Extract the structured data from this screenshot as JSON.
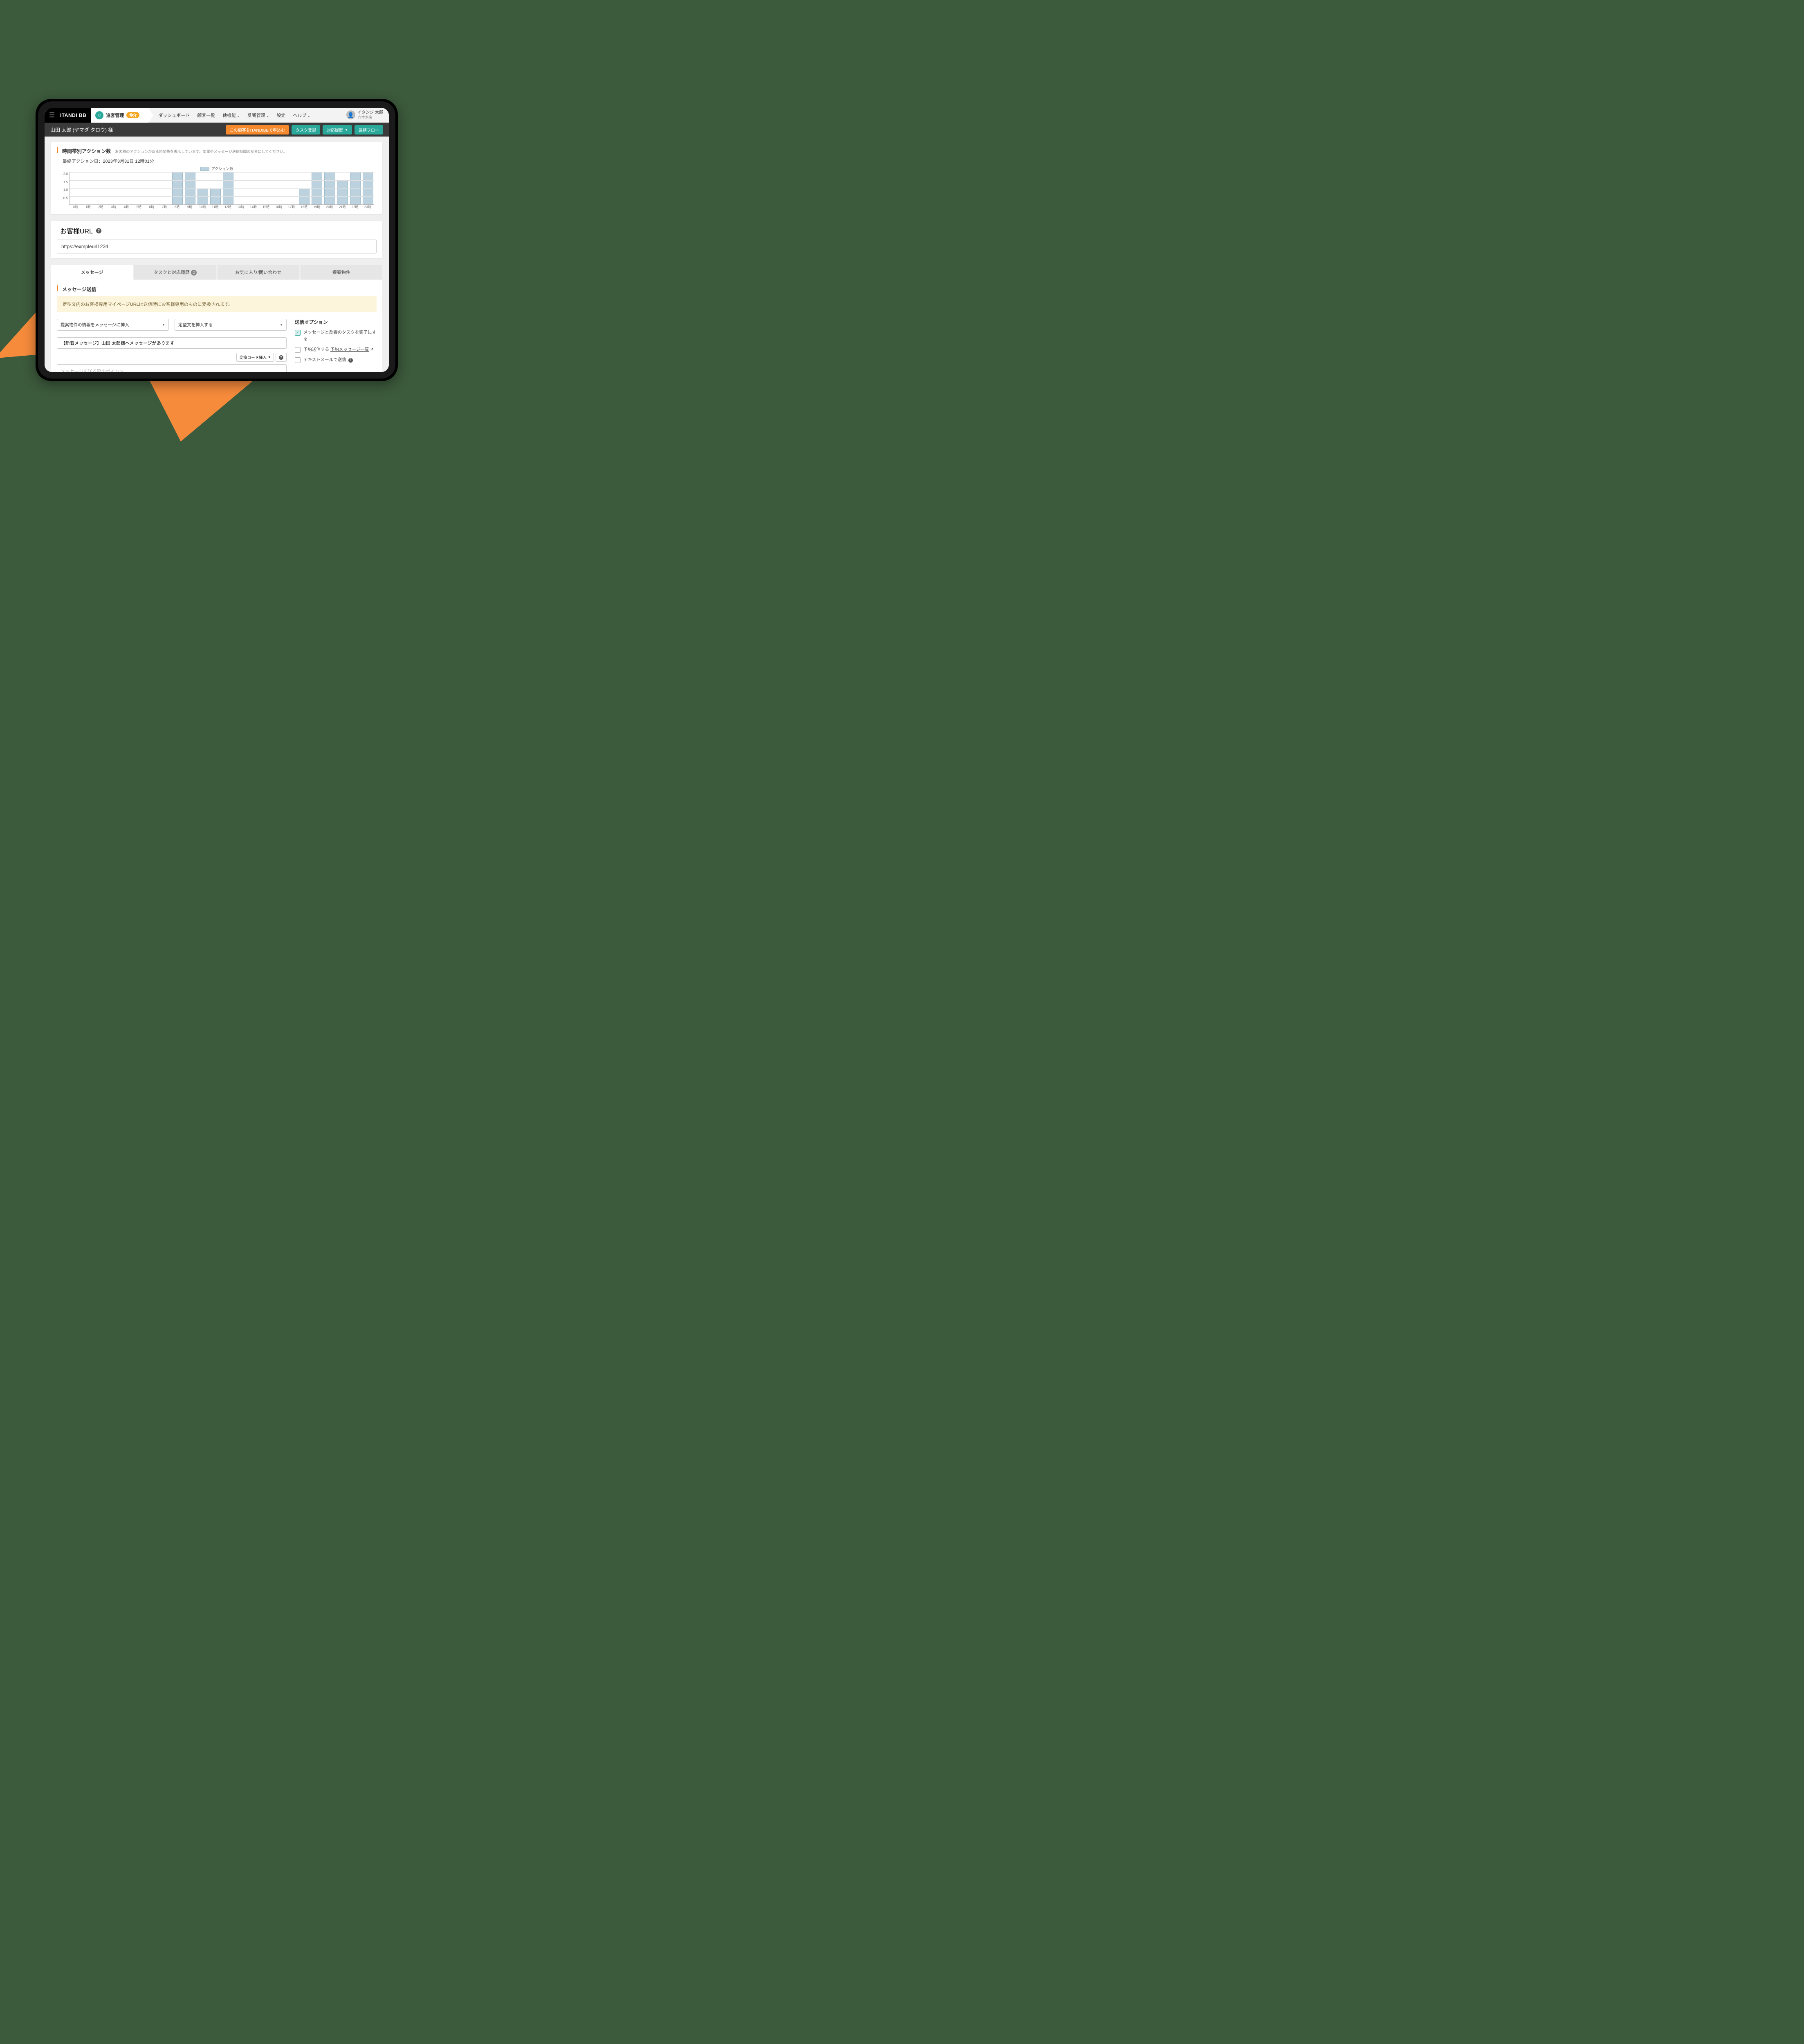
{
  "nav": {
    "logo": "ITANDI BB",
    "app_name": "追客管理",
    "app_badge": "仲介",
    "items": [
      "ダッシュボード",
      "顧客一覧",
      "他機能",
      "反響管理",
      "設定",
      "ヘルプ"
    ],
    "items_caret": [
      false,
      false,
      true,
      true,
      false,
      true
    ],
    "user_name": "イタンジ 太郎",
    "user_store": "六本木店"
  },
  "subheader": {
    "title": "山田 太郎 (ヤマダ タロウ) 様",
    "btn_apply": "この顧客をITANDIBBで申込む",
    "btn_task": "タスク登録",
    "btn_history": "対応履歴",
    "btn_flow": "業務フロー"
  },
  "actions_sec": {
    "title": "時間帯別アクション数",
    "subtitle": "お客様のアクションがある時間帯を表示しています。架電やメッセージ送信時間の参考にしてください。",
    "last_action": "最終アクション日：2023年3月31日 12時01分",
    "legend": "アクション数"
  },
  "chart_data": {
    "type": "bar",
    "categories": [
      "0時",
      "1時",
      "2時",
      "3時",
      "4時",
      "5時",
      "6時",
      "7時",
      "8時",
      "9時",
      "10時",
      "11時",
      "12時",
      "13時",
      "14時",
      "15時",
      "16時",
      "17時",
      "18時",
      "19時",
      "20時",
      "21時",
      "22時",
      "23時"
    ],
    "values": [
      0,
      0,
      0,
      0,
      0,
      0,
      0,
      0,
      2,
      2,
      1,
      1,
      2,
      0,
      0,
      0,
      0,
      0,
      1,
      2,
      2,
      1.5,
      2,
      2
    ],
    "yticks": [
      "2.0",
      "1.5",
      "1.0",
      "0.5"
    ],
    "ylim": [
      0,
      2
    ],
    "xlabel": "",
    "ylabel": ""
  },
  "url_sec": {
    "title": "お客様URL",
    "value": "https://exmpleurl1234"
  },
  "tabs": {
    "items": [
      "メッセージ",
      "タスクと対応履歴",
      "お気に入り/問い合わせ",
      "提案物件"
    ],
    "badge_idx": 1,
    "badge_val": "2",
    "active_idx": 0
  },
  "msg_sec": {
    "title": "メッセージ送信",
    "notice": "定型文内のお客様専用マイページURLは送信時にお客様専用のものに変換されます。",
    "sel1": "提案物件の情報をメッセージに挿入",
    "sel2": "定型文を挿入する",
    "subject": "【新着メッセージ】山田 太郎様へメッセージがあります",
    "btn_code": "変換コード挿入",
    "body_ph": "メッセージを送る際のポイント",
    "opt_title": "送信オプション",
    "opt1": "メッセージと反響のタスクを完了にする",
    "opt2_a": "予約送信する",
    "opt2_b": "予約メッセージ一覧",
    "opt3": "テキストメールで送信"
  }
}
